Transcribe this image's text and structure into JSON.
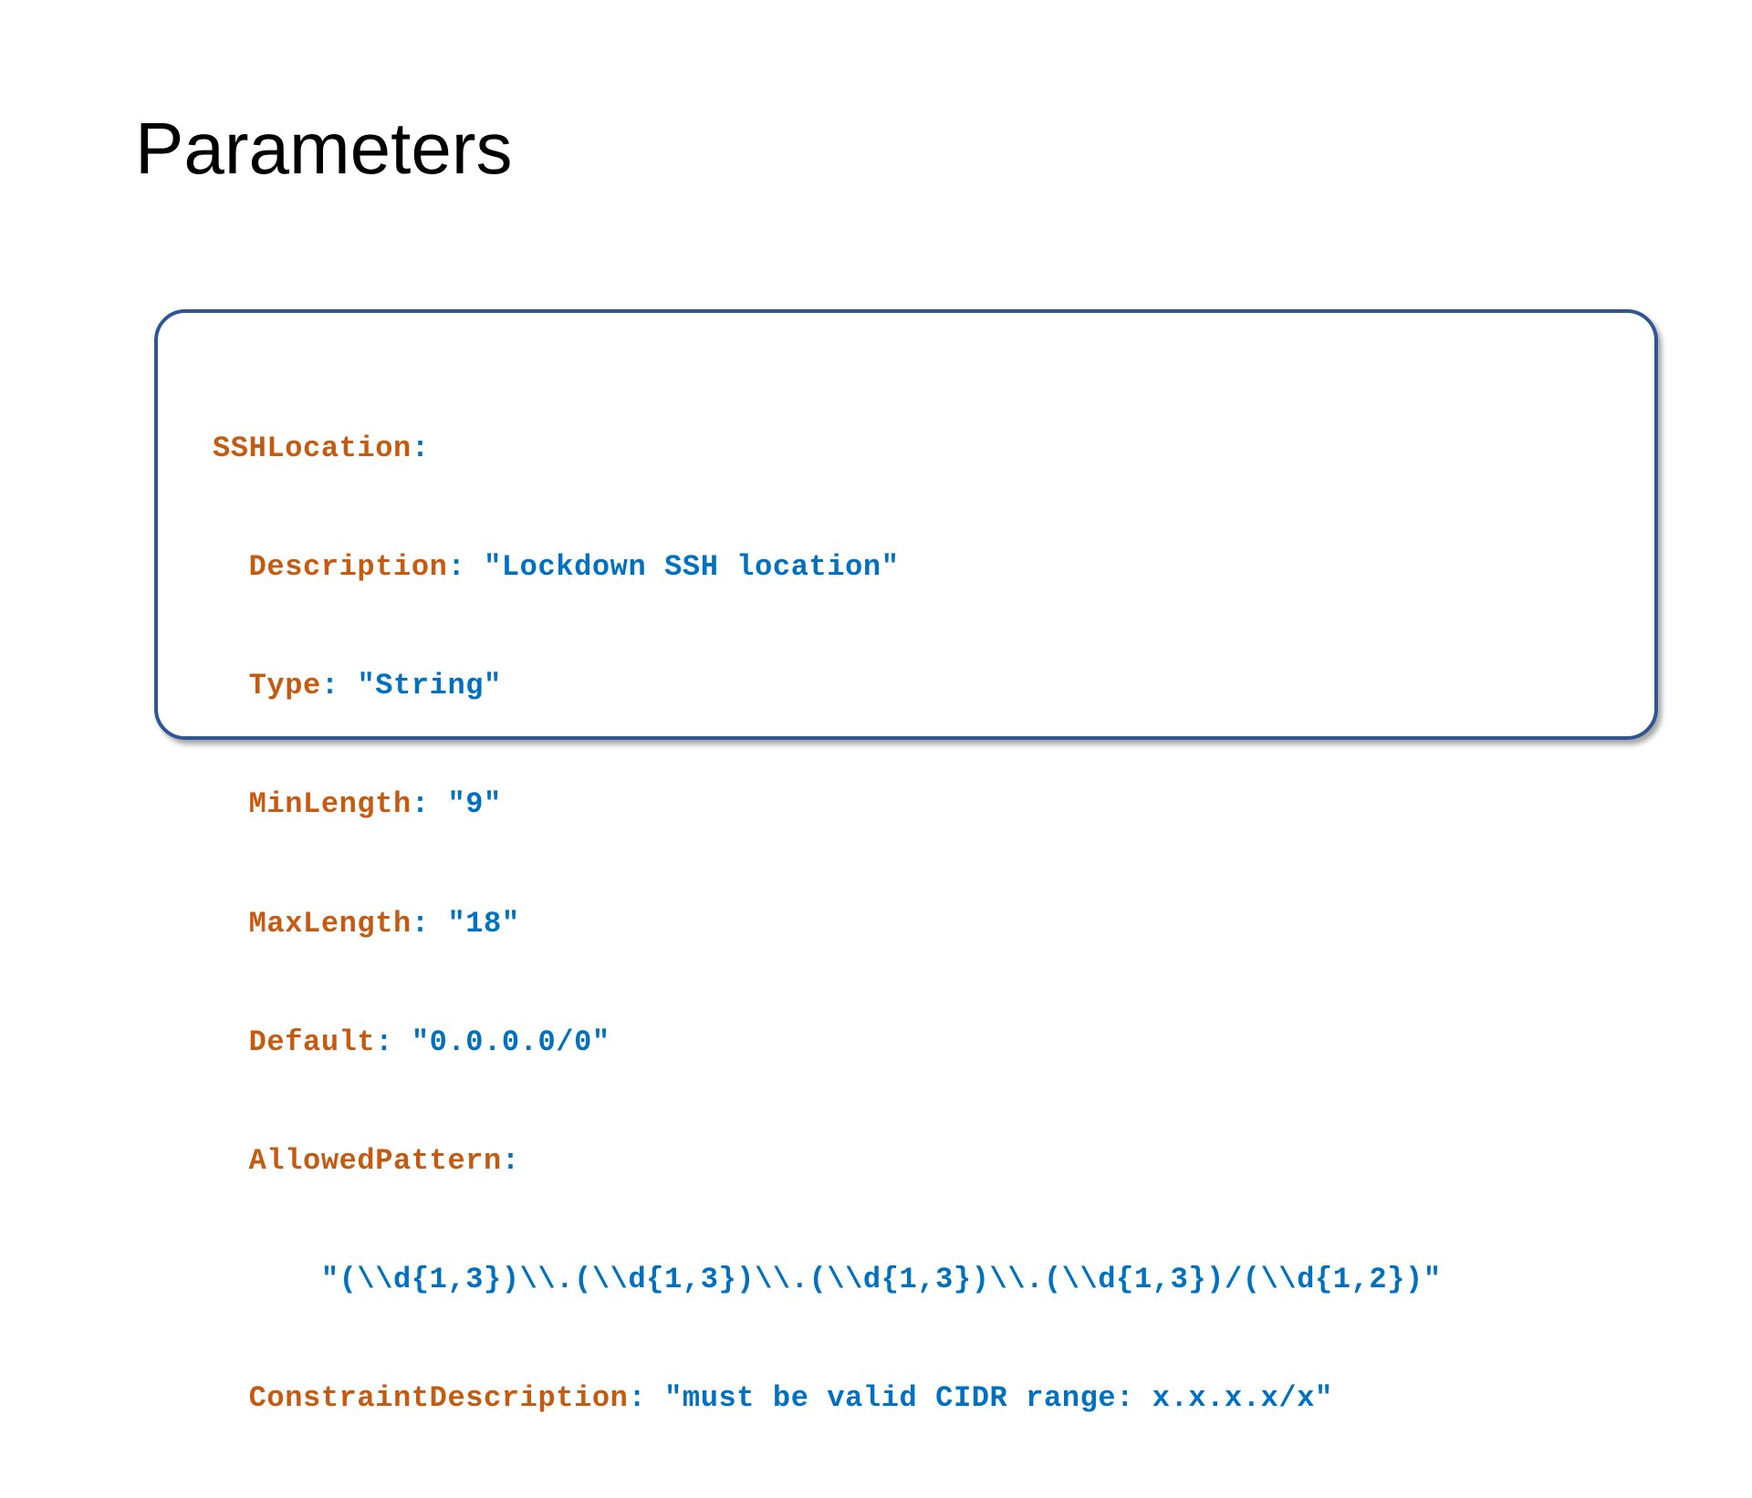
{
  "slide": {
    "title": "Parameters"
  },
  "code": {
    "lines": [
      {
        "indent": "",
        "key": "SSHLocation",
        "sep": ":",
        "value": ""
      },
      {
        "indent": "  ",
        "key": "Description",
        "sep": ": ",
        "value": "\"Lockdown SSH location\""
      },
      {
        "indent": "  ",
        "key": "Type",
        "sep": ": ",
        "value": "\"String\""
      },
      {
        "indent": "  ",
        "key": "MinLength",
        "sep": ": ",
        "value": "\"9\""
      },
      {
        "indent": "  ",
        "key": "MaxLength",
        "sep": ": ",
        "value": "\"18\""
      },
      {
        "indent": "  ",
        "key": "Default",
        "sep": ": ",
        "value": "\"0.0.0.0/0\""
      },
      {
        "indent": "  ",
        "key": "AllowedPattern",
        "sep": ":",
        "value": ""
      },
      {
        "indent": "      ",
        "key": "",
        "sep": "",
        "value": "\"(\\\\d{1,3})\\\\.(\\\\d{1,3})\\\\.(\\\\d{1,3})\\\\.(\\\\d{1,3})/(\\\\d{1,2})\""
      },
      {
        "indent": "  ",
        "key": "ConstraintDescription",
        "sep": ": ",
        "value": "\"must be valid CIDR range: x.x.x.x/x\""
      }
    ]
  },
  "colors": {
    "key": "#c55a11",
    "value": "#0070c0",
    "box_border": "#2f5597"
  }
}
